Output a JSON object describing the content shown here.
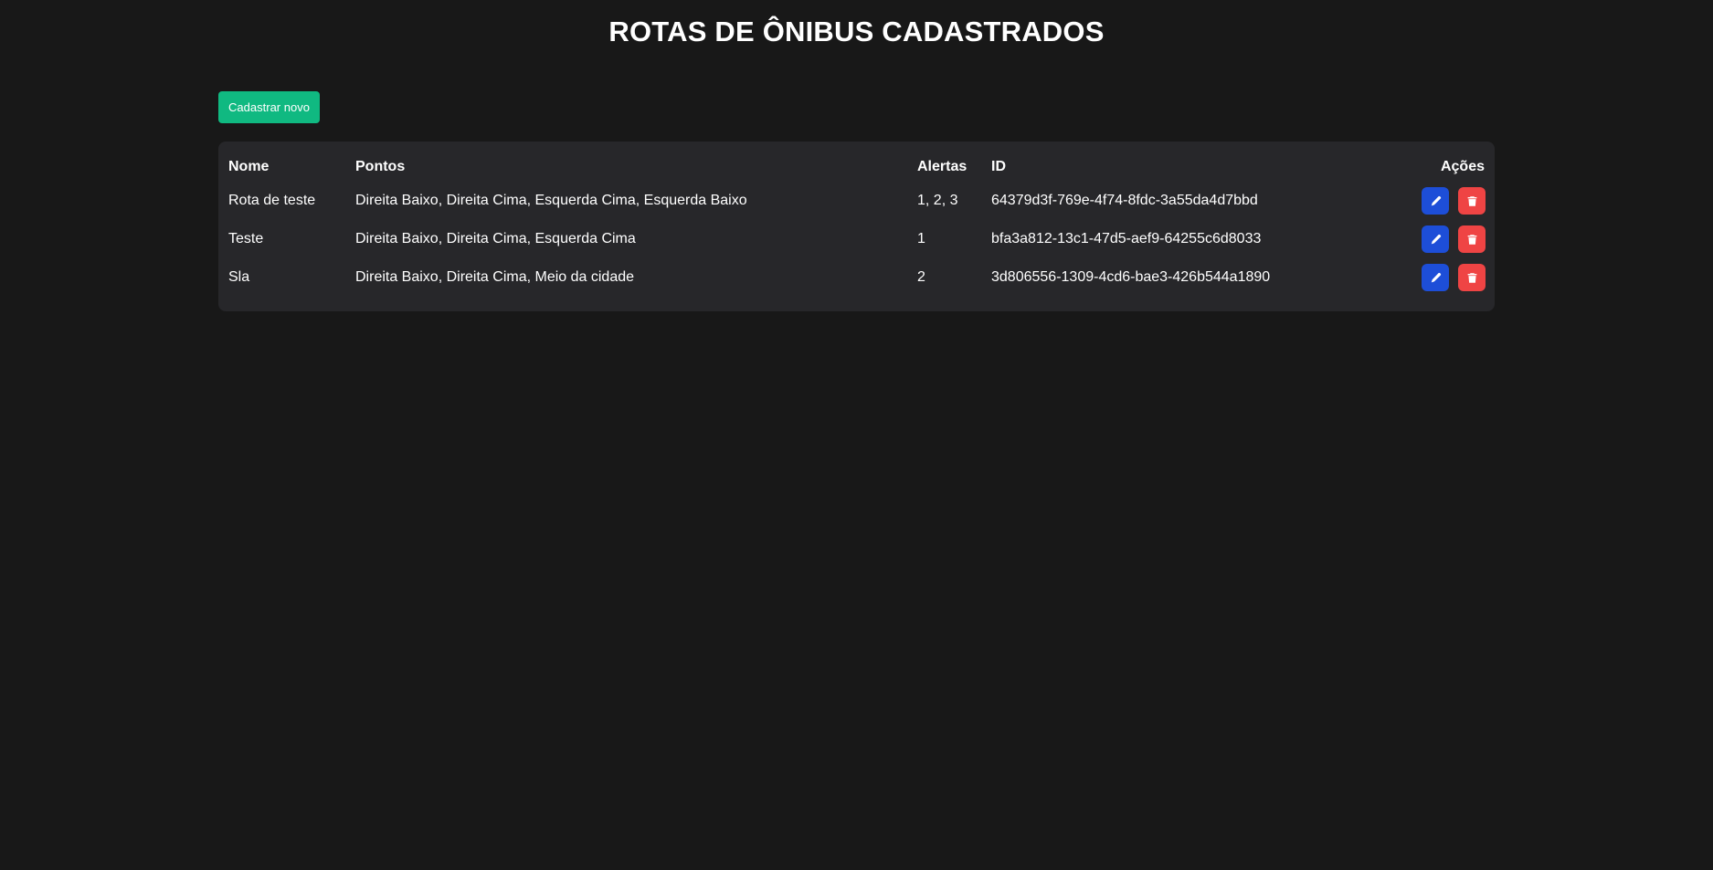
{
  "page": {
    "title": "ROTAS DE ÔNIBUS CADASTRADOS"
  },
  "toolbar": {
    "new_label": "Cadastrar novo"
  },
  "table": {
    "headers": {
      "nome": "Nome",
      "pontos": "Pontos",
      "alertas": "Alertas",
      "id": "ID",
      "acoes": "Ações"
    },
    "rows": [
      {
        "nome": "Rota de teste",
        "pontos": "Direita Baixo, Direita Cima, Esquerda Cima, Esquerda Baixo",
        "alertas": "1, 2, 3",
        "id": "64379d3f-769e-4f74-8fdc-3a55da4d7bbd"
      },
      {
        "nome": "Teste",
        "pontos": "Direita Baixo, Direita Cima, Esquerda Cima",
        "alertas": "1",
        "id": "bfa3a812-13c1-47d5-aef9-64255c6d8033"
      },
      {
        "nome": "Sla",
        "pontos": "Direita Baixo, Direita Cima, Meio da cidade",
        "alertas": "2",
        "id": "3d806556-1309-4cd6-bae3-426b544a1890"
      }
    ]
  },
  "icons": {
    "edit": "pencil-icon",
    "delete": "trash-icon"
  },
  "colors": {
    "background": "#181818",
    "card": "#27272a",
    "primary_action": "#10b981",
    "edit_button": "#1d4ed8",
    "delete_button": "#ef4444",
    "text": "#ffffff"
  }
}
